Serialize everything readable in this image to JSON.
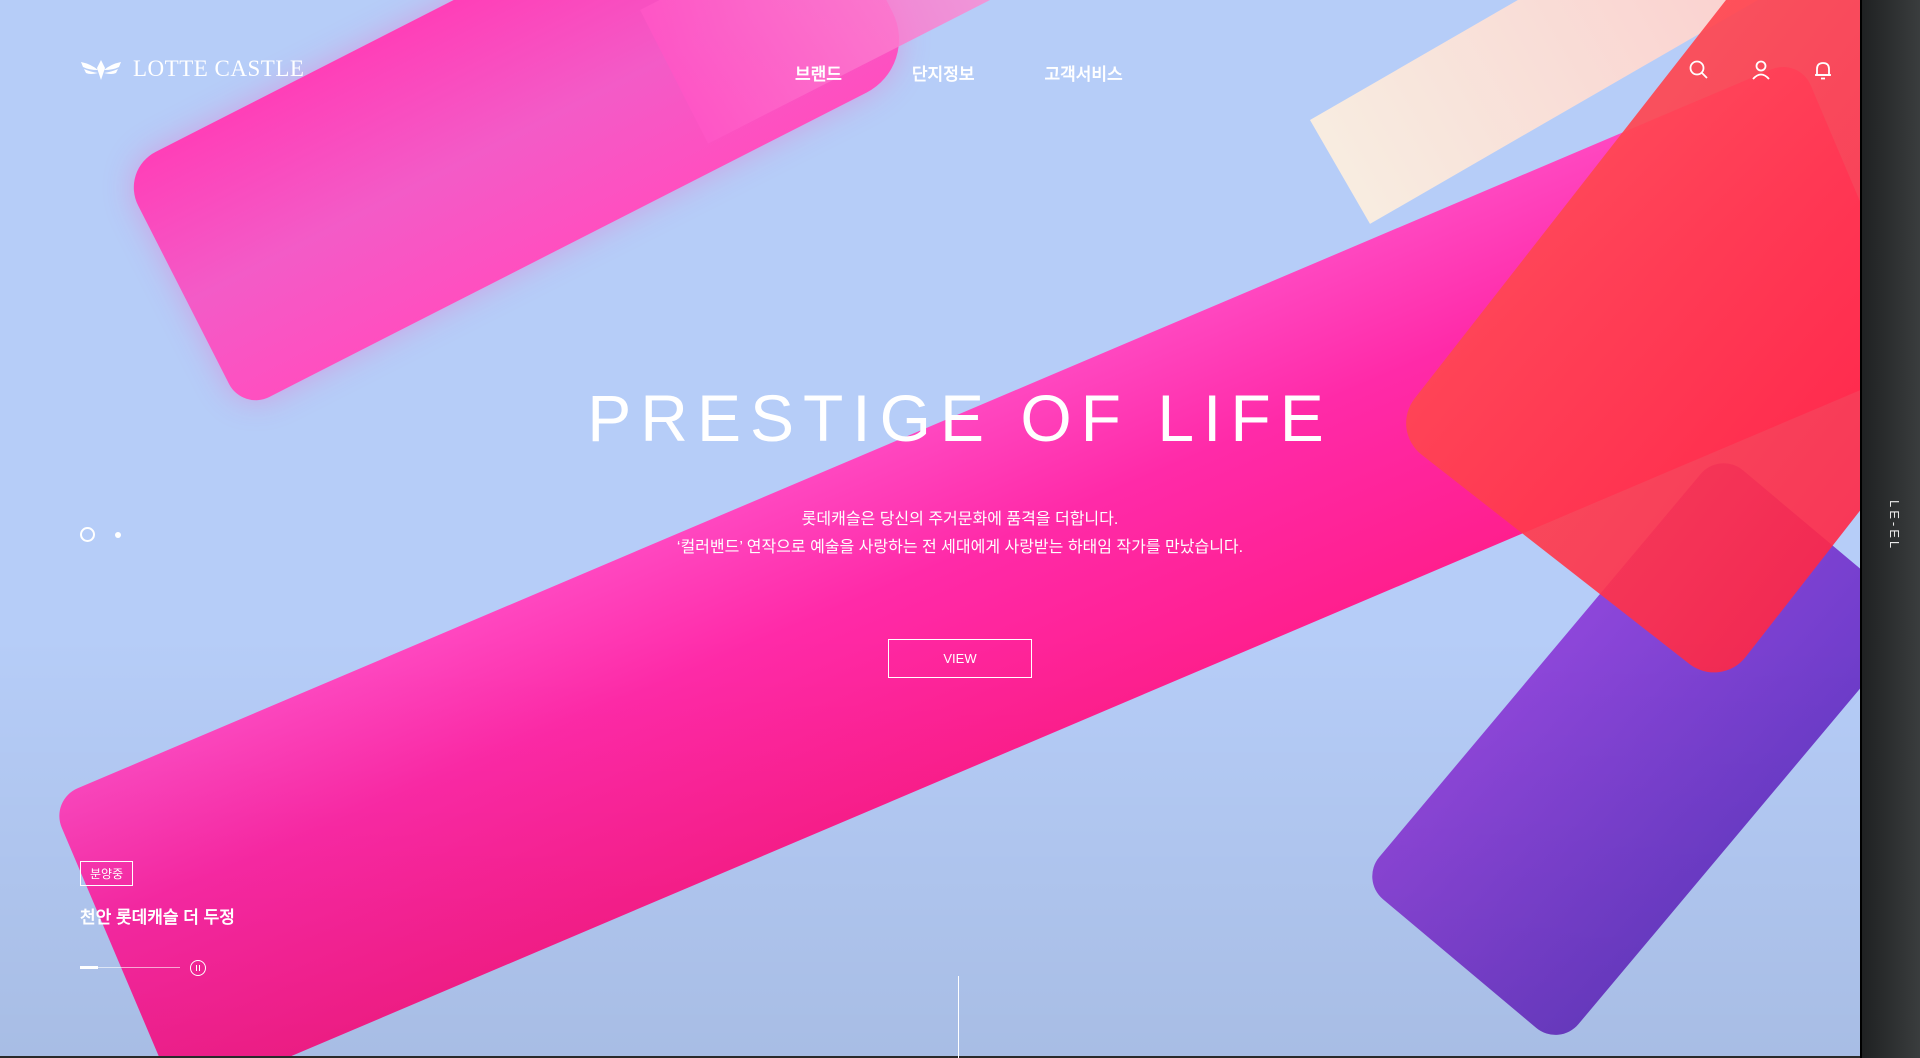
{
  "header": {
    "logo_text": "LOTTE CASTLE",
    "nav": [
      "브랜드",
      "단지정보",
      "고객서비스"
    ],
    "icons": [
      "search-icon",
      "user-icon",
      "bell-icon"
    ]
  },
  "hero": {
    "headline": "PRESTIGE OF LIFE",
    "sub_line1": "롯데캐슬은 당신의 주거문화에 품격을 더합니다.",
    "sub_line2": "‘컬러밴드’ 연작으로 예술을 사랑하는 전 세대에게 사랑받는 하태임 작가를 만났습니다.",
    "button_label": "VIEW",
    "slide_count": 2,
    "active_slide": 1
  },
  "project": {
    "badge": "분양중",
    "name": "천안 롯데캐슬 더 두정",
    "progress": 0.18
  },
  "rail": {
    "text": "LE-EL"
  },
  "colors": {
    "sky": "#b6cdf8",
    "pink": "#ff2aa8",
    "red": "#ff3a4f",
    "purple": "#7a3ad0"
  }
}
